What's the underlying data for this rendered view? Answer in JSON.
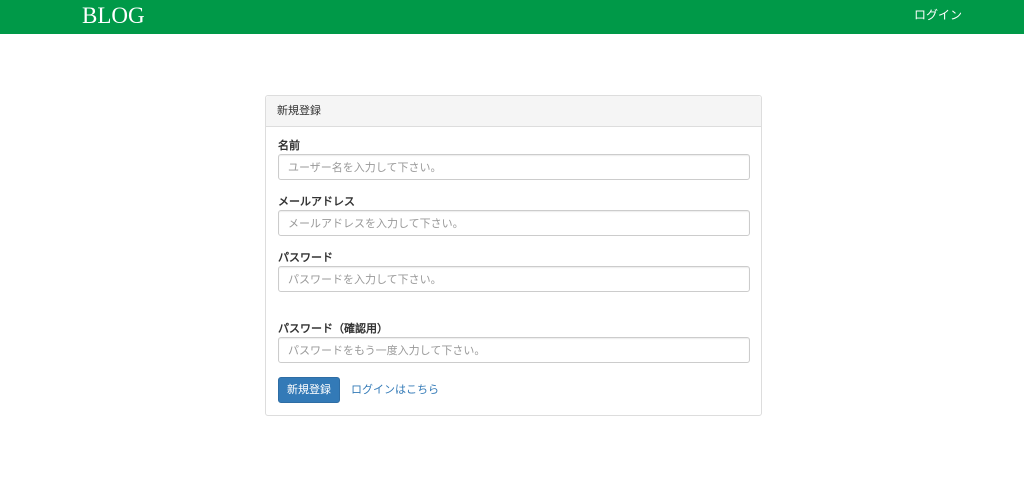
{
  "navbar": {
    "brand": "BLOG",
    "login_label": "ログイン",
    "background_color": "#009948"
  },
  "panel": {
    "heading": "新規登録",
    "fields": [
      {
        "label": "名前",
        "placeholder": "ユーザー名を入力して下さい。",
        "value": ""
      },
      {
        "label": "メールアドレス",
        "placeholder": "メールアドレスを入力して下さい。",
        "value": ""
      },
      {
        "label": "パスワード",
        "placeholder": "パスワードを入力して下さい。",
        "value": ""
      },
      {
        "label": "パスワード（確認用）",
        "placeholder": "パスワードをもう一度入力して下さい。",
        "value": ""
      }
    ],
    "submit_label": "新規登録",
    "login_link": "ログインはこちら",
    "primary_color": "#337ab7"
  }
}
